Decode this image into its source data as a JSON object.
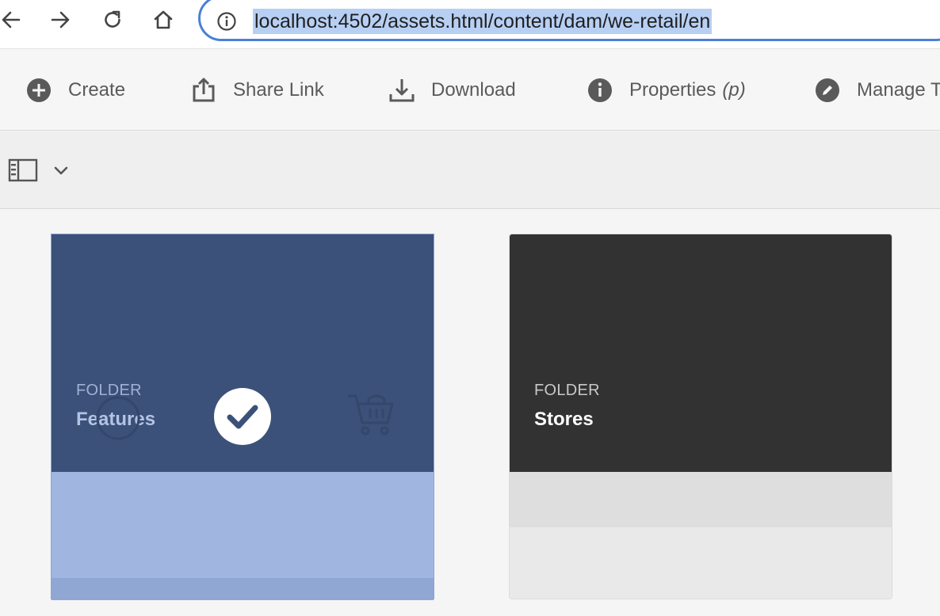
{
  "browser": {
    "url": "localhost:4502/assets.html/content/dam/we-retail/en",
    "url_highlight": "#b7cff3",
    "focus_ring": "#4a80d6",
    "icons": [
      "back-arrow-icon",
      "forward-arrow-icon",
      "reload-icon",
      "home-icon",
      "info-icon"
    ]
  },
  "actionbar": {
    "create": {
      "label": "Create",
      "icon": "add-circle-icon"
    },
    "share": {
      "label": "Share Link",
      "icon": "share-icon"
    },
    "download": {
      "label": "Download",
      "icon": "download-icon"
    },
    "properties": {
      "label": "Properties",
      "hint": "(p)",
      "icon": "info-circle-icon"
    },
    "manage": {
      "label": "Manage T",
      "icon": "edit-pencil-icon"
    }
  },
  "viewbar": {
    "rail_toggle_icon": "rail-toggle-icon",
    "chevron_icon": "chevron-down-icon"
  },
  "cards": [
    {
      "type": "FOLDER",
      "title": "Features",
      "selected": true,
      "thumb_color": "#3b5179",
      "footer_color": "#a0b5e0",
      "quick_actions": [
        "target-icon",
        "checkmark-icon",
        "cart-icon"
      ]
    },
    {
      "type": "FOLDER",
      "title": "Stores",
      "selected": false,
      "thumb_color": "#323232",
      "footer_color": "#dedede"
    }
  ]
}
